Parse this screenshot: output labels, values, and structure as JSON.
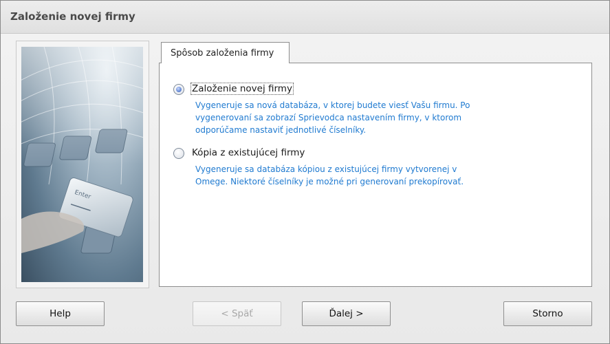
{
  "window": {
    "title": "Založenie novej firmy"
  },
  "tab": {
    "label": "Spôsob založenia firmy"
  },
  "options": [
    {
      "label": "Založenie novej firmy",
      "checked": true,
      "description_lines": [
        "Vygeneruje sa nová databáza, v ktorej budete viesť Vašu firmu. Po",
        "vygenerovaní sa zobrazí Sprievodca nastavením firmy, v ktorom",
        "odporúčame nastaviť jednotlivé číselníky."
      ]
    },
    {
      "label": "Kópia z existujúcej firmy",
      "checked": false,
      "description_lines": [
        "Vygeneruje sa databáza kópiou z existujúcej firmy vytvorenej v",
        "Omege. Niektoré číselníky je možné pri generovaní prekopírovať."
      ]
    }
  ],
  "buttons": {
    "help": "Help",
    "back": "< Späť",
    "next": "Ďalej >",
    "cancel": "Storno"
  },
  "colors": {
    "description_text": "#1f7ad0",
    "title_text": "#4a4a4a"
  }
}
